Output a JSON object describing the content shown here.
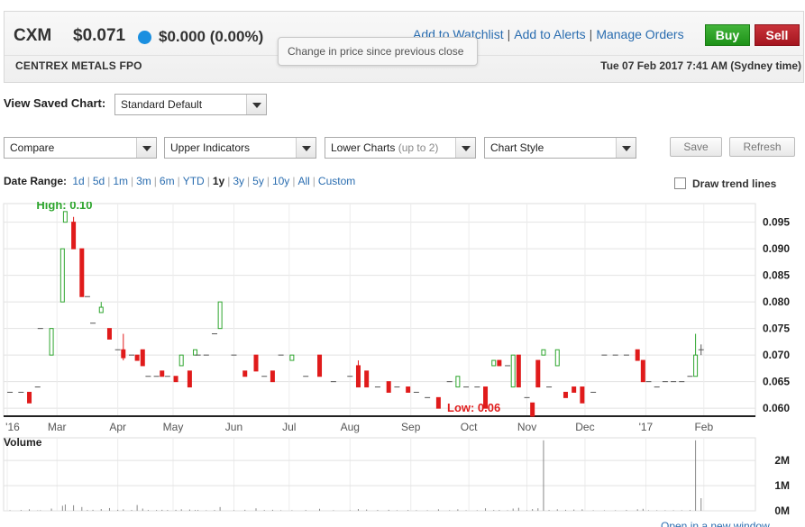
{
  "quote": {
    "ticker": "CXM",
    "price": "$0.071",
    "change": "$0.000 (0.00%)",
    "company": "CENTREX METALS FPO",
    "datetime": "Tue 07 Feb 2017 7:41 AM (Sydney time)",
    "tooltip": "Change in price since previous close"
  },
  "links": {
    "watchlist": "Add to Watchlist",
    "alerts": "Add to Alerts",
    "orders": "Manage Orders"
  },
  "buttons": {
    "buy": "Buy",
    "sell": "Sell",
    "save": "Save",
    "refresh": "Refresh"
  },
  "saved_chart": {
    "label": "View Saved Chart:",
    "value": "Standard Default"
  },
  "controls": {
    "compare": "Compare",
    "upper": "Upper Indicators",
    "lower": "Lower Charts",
    "lower_hint": "(up to 2)",
    "style": "Chart Style"
  },
  "date_range": {
    "label": "Date Range:",
    "options": [
      "1d",
      "5d",
      "1m",
      "3m",
      "6m",
      "YTD",
      "1y",
      "3y",
      "5y",
      "10y",
      "All",
      "Custom"
    ],
    "active": "1y"
  },
  "trend_label": "Draw trend lines",
  "open_window": "Open in a new window",
  "colors": {
    "up": "#2da52d",
    "down": "#e01b1b",
    "neutral": "#555555",
    "accent": "#1a8fe0"
  },
  "chart_data": {
    "type": "candlestick",
    "high_label": "High: 0.10",
    "low_label": "Low: 0.06",
    "ylim": [
      0.0585,
      0.0985
    ],
    "yticks": [
      0.095,
      0.09,
      0.085,
      0.08,
      0.075,
      0.07,
      0.065,
      0.06
    ],
    "ytick_labels": [
      "0.095",
      "0.090",
      "0.085",
      "0.080",
      "0.075",
      "0.070",
      "0.065",
      "0.060"
    ],
    "xrange": [
      0,
      270
    ],
    "xticks": [
      {
        "label": "'16",
        "x": 0
      },
      {
        "label": "Mar",
        "x": 18
      },
      {
        "label": "Apr",
        "x": 40
      },
      {
        "label": "May",
        "x": 60
      },
      {
        "label": "Jun",
        "x": 82
      },
      {
        "label": "Jul",
        "x": 102
      },
      {
        "label": "Aug",
        "x": 124
      },
      {
        "label": "Sep",
        "x": 146
      },
      {
        "label": "Oct",
        "x": 167
      },
      {
        "label": "Nov",
        "x": 188
      },
      {
        "label": "Dec",
        "x": 209
      },
      {
        "label": "'17",
        "x": 231
      },
      {
        "label": "Feb",
        "x": 252
      }
    ],
    "volume_label": "Volume",
    "volume_ticks": [
      "2M",
      "1M",
      "0M"
    ],
    "volume_ylim": [
      0,
      2900000
    ],
    "candles": [
      {
        "x": 1,
        "o": 0.063,
        "c": 0.063,
        "h": 0.063,
        "l": 0.063,
        "v": 20000
      },
      {
        "x": 5,
        "o": 0.063,
        "c": 0.063,
        "h": 0.063,
        "l": 0.063,
        "v": 30000
      },
      {
        "x": 8,
        "o": 0.063,
        "c": 0.061,
        "h": 0.063,
        "l": 0.061,
        "v": 60000
      },
      {
        "x": 11,
        "o": 0.064,
        "c": 0.064,
        "h": 0.064,
        "l": 0.064,
        "v": 15000
      },
      {
        "x": 12,
        "o": 0.075,
        "c": 0.075,
        "h": 0.075,
        "l": 0.075,
        "v": 20000
      },
      {
        "x": 16,
        "o": 0.07,
        "c": 0.075,
        "h": 0.075,
        "l": 0.07,
        "v": 90000
      },
      {
        "x": 20,
        "o": 0.08,
        "c": 0.09,
        "h": 0.09,
        "l": 0.08,
        "v": 200000
      },
      {
        "x": 21,
        "o": 0.095,
        "c": 0.097,
        "h": 0.097,
        "l": 0.095,
        "v": 250000
      },
      {
        "x": 24,
        "o": 0.095,
        "c": 0.09,
        "h": 0.096,
        "l": 0.09,
        "v": 220000
      },
      {
        "x": 27,
        "o": 0.09,
        "c": 0.081,
        "h": 0.09,
        "l": 0.081,
        "v": 150000
      },
      {
        "x": 29,
        "o": 0.081,
        "c": 0.081,
        "h": 0.081,
        "l": 0.081,
        "v": 30000
      },
      {
        "x": 31,
        "o": 0.076,
        "c": 0.076,
        "h": 0.076,
        "l": 0.076,
        "v": 40000
      },
      {
        "x": 34,
        "o": 0.078,
        "c": 0.079,
        "h": 0.08,
        "l": 0.078,
        "v": 70000
      },
      {
        "x": 37,
        "o": 0.075,
        "c": 0.073,
        "h": 0.075,
        "l": 0.073,
        "v": 110000
      },
      {
        "x": 40,
        "o": 0.071,
        "c": 0.071,
        "h": 0.071,
        "l": 0.071,
        "v": 40000
      },
      {
        "x": 42,
        "o": 0.071,
        "c": 0.0695,
        "h": 0.074,
        "l": 0.069,
        "v": 60000
      },
      {
        "x": 45,
        "o": 0.07,
        "c": 0.07,
        "h": 0.07,
        "l": 0.07,
        "v": 30000
      },
      {
        "x": 47,
        "o": 0.07,
        "c": 0.069,
        "h": 0.07,
        "l": 0.069,
        "v": 230000
      },
      {
        "x": 49,
        "o": 0.071,
        "c": 0.068,
        "h": 0.071,
        "l": 0.068,
        "v": 90000
      },
      {
        "x": 51,
        "o": 0.066,
        "c": 0.066,
        "h": 0.066,
        "l": 0.066,
        "v": 30000
      },
      {
        "x": 54,
        "o": 0.066,
        "c": 0.066,
        "h": 0.066,
        "l": 0.066,
        "v": 30000
      },
      {
        "x": 56,
        "o": 0.067,
        "c": 0.066,
        "h": 0.067,
        "l": 0.066,
        "v": 40000
      },
      {
        "x": 58,
        "o": 0.066,
        "c": 0.066,
        "h": 0.066,
        "l": 0.066,
        "v": 30000
      },
      {
        "x": 61,
        "o": 0.066,
        "c": 0.065,
        "h": 0.066,
        "l": 0.065,
        "v": 40000
      },
      {
        "x": 63,
        "o": 0.068,
        "c": 0.07,
        "h": 0.07,
        "l": 0.068,
        "v": 60000
      },
      {
        "x": 66,
        "o": 0.067,
        "c": 0.064,
        "h": 0.067,
        "l": 0.064,
        "v": 50000
      },
      {
        "x": 68,
        "o": 0.07,
        "c": 0.071,
        "h": 0.071,
        "l": 0.07,
        "v": 30000
      },
      {
        "x": 69,
        "o": 0.07,
        "c": 0.07,
        "h": 0.07,
        "l": 0.07,
        "v": 30000
      },
      {
        "x": 72,
        "o": 0.07,
        "c": 0.07,
        "h": 0.07,
        "l": 0.07,
        "v": 20000
      },
      {
        "x": 75,
        "o": 0.074,
        "c": 0.074,
        "h": 0.074,
        "l": 0.074,
        "v": 30000
      },
      {
        "x": 77,
        "o": 0.075,
        "c": 0.08,
        "h": 0.08,
        "l": 0.075,
        "v": 150000
      },
      {
        "x": 82,
        "o": 0.07,
        "c": 0.07,
        "h": 0.07,
        "l": 0.07,
        "v": 20000
      },
      {
        "x": 86,
        "o": 0.067,
        "c": 0.066,
        "h": 0.067,
        "l": 0.066,
        "v": 40000
      },
      {
        "x": 90,
        "o": 0.07,
        "c": 0.067,
        "h": 0.07,
        "l": 0.067,
        "v": 100000
      },
      {
        "x": 93,
        "o": 0.066,
        "c": 0.066,
        "h": 0.066,
        "l": 0.066,
        "v": 30000
      },
      {
        "x": 96,
        "o": 0.067,
        "c": 0.065,
        "h": 0.067,
        "l": 0.065,
        "v": 40000
      },
      {
        "x": 99,
        "o": 0.07,
        "c": 0.07,
        "h": 0.07,
        "l": 0.07,
        "v": 20000
      },
      {
        "x": 103,
        "o": 0.069,
        "c": 0.07,
        "h": 0.07,
        "l": 0.069,
        "v": 20000
      },
      {
        "x": 108,
        "o": 0.066,
        "c": 0.066,
        "h": 0.066,
        "l": 0.066,
        "v": 30000
      },
      {
        "x": 113,
        "o": 0.07,
        "c": 0.066,
        "h": 0.07,
        "l": 0.066,
        "v": 80000
      },
      {
        "x": 118,
        "o": 0.065,
        "c": 0.065,
        "h": 0.065,
        "l": 0.065,
        "v": 20000
      },
      {
        "x": 124,
        "o": 0.066,
        "c": 0.066,
        "h": 0.066,
        "l": 0.066,
        "v": 20000
      },
      {
        "x": 127,
        "o": 0.068,
        "c": 0.064,
        "h": 0.069,
        "l": 0.064,
        "v": 70000
      },
      {
        "x": 130,
        "o": 0.067,
        "c": 0.064,
        "h": 0.067,
        "l": 0.064,
        "v": 50000
      },
      {
        "x": 134,
        "o": 0.064,
        "c": 0.064,
        "h": 0.064,
        "l": 0.064,
        "v": 30000
      },
      {
        "x": 138,
        "o": 0.065,
        "c": 0.063,
        "h": 0.065,
        "l": 0.063,
        "v": 40000
      },
      {
        "x": 141,
        "o": 0.064,
        "c": 0.064,
        "h": 0.064,
        "l": 0.064,
        "v": 20000
      },
      {
        "x": 145,
        "o": 0.064,
        "c": 0.063,
        "h": 0.064,
        "l": 0.063,
        "v": 30000
      },
      {
        "x": 148,
        "o": 0.063,
        "c": 0.063,
        "h": 0.063,
        "l": 0.063,
        "v": 20000
      },
      {
        "x": 152,
        "o": 0.062,
        "c": 0.062,
        "h": 0.062,
        "l": 0.062,
        "v": 20000
      },
      {
        "x": 156,
        "o": 0.062,
        "c": 0.06,
        "h": 0.062,
        "l": 0.06,
        "v": 60000
      },
      {
        "x": 160,
        "o": 0.065,
        "c": 0.065,
        "h": 0.065,
        "l": 0.065,
        "v": 20000
      },
      {
        "x": 163,
        "o": 0.064,
        "c": 0.066,
        "h": 0.066,
        "l": 0.064,
        "v": 60000
      },
      {
        "x": 166,
        "o": 0.064,
        "c": 0.064,
        "h": 0.064,
        "l": 0.064,
        "v": 20000
      },
      {
        "x": 170,
        "o": 0.064,
        "c": 0.064,
        "h": 0.064,
        "l": 0.064,
        "v": 20000
      },
      {
        "x": 173,
        "o": 0.064,
        "c": 0.06,
        "h": 0.064,
        "l": 0.06,
        "v": 100000
      },
      {
        "x": 176,
        "o": 0.068,
        "c": 0.069,
        "h": 0.069,
        "l": 0.068,
        "v": 30000
      },
      {
        "x": 178,
        "o": 0.069,
        "c": 0.068,
        "h": 0.069,
        "l": 0.068,
        "v": 30000
      },
      {
        "x": 181,
        "o": 0.068,
        "c": 0.068,
        "h": 0.068,
        "l": 0.068,
        "v": 20000
      },
      {
        "x": 183,
        "o": 0.064,
        "c": 0.07,
        "h": 0.07,
        "l": 0.064,
        "v": 90000
      },
      {
        "x": 185,
        "o": 0.07,
        "c": 0.064,
        "h": 0.07,
        "l": 0.064,
        "v": 120000
      },
      {
        "x": 188,
        "o": 0.062,
        "c": 0.062,
        "h": 0.062,
        "l": 0.062,
        "v": 20000
      },
      {
        "x": 190,
        "o": 0.061,
        "c": 0.0585,
        "h": 0.061,
        "l": 0.0585,
        "v": 70000
      },
      {
        "x": 192,
        "o": 0.069,
        "c": 0.064,
        "h": 0.069,
        "l": 0.064,
        "v": 100000
      },
      {
        "x": 194,
        "o": 0.07,
        "c": 0.071,
        "h": 0.071,
        "l": 0.07,
        "v": 2800000
      },
      {
        "x": 196,
        "o": 0.064,
        "c": 0.064,
        "h": 0.064,
        "l": 0.064,
        "v": 30000
      },
      {
        "x": 199,
        "o": 0.068,
        "c": 0.071,
        "h": 0.071,
        "l": 0.068,
        "v": 60000
      },
      {
        "x": 202,
        "o": 0.063,
        "c": 0.062,
        "h": 0.063,
        "l": 0.062,
        "v": 40000
      },
      {
        "x": 205,
        "o": 0.064,
        "c": 0.063,
        "h": 0.064,
        "l": 0.063,
        "v": 50000
      },
      {
        "x": 208,
        "o": 0.064,
        "c": 0.061,
        "h": 0.064,
        "l": 0.061,
        "v": 60000
      },
      {
        "x": 212,
        "o": 0.063,
        "c": 0.063,
        "h": 0.063,
        "l": 0.063,
        "v": 20000
      },
      {
        "x": 216,
        "o": 0.07,
        "c": 0.07,
        "h": 0.07,
        "l": 0.07,
        "v": 20000
      },
      {
        "x": 220,
        "o": 0.07,
        "c": 0.07,
        "h": 0.07,
        "l": 0.07,
        "v": 20000
      },
      {
        "x": 224,
        "o": 0.07,
        "c": 0.07,
        "h": 0.07,
        "l": 0.07,
        "v": 30000
      },
      {
        "x": 228,
        "o": 0.071,
        "c": 0.069,
        "h": 0.071,
        "l": 0.069,
        "v": 60000
      },
      {
        "x": 230,
        "o": 0.069,
        "c": 0.065,
        "h": 0.069,
        "l": 0.065,
        "v": 80000
      },
      {
        "x": 232,
        "o": 0.065,
        "c": 0.065,
        "h": 0.065,
        "l": 0.065,
        "v": 20000
      },
      {
        "x": 235,
        "o": 0.064,
        "c": 0.064,
        "h": 0.064,
        "l": 0.064,
        "v": 20000
      },
      {
        "x": 238,
        "o": 0.065,
        "c": 0.065,
        "h": 0.065,
        "l": 0.065,
        "v": 20000
      },
      {
        "x": 241,
        "o": 0.065,
        "c": 0.065,
        "h": 0.065,
        "l": 0.065,
        "v": 20000
      },
      {
        "x": 244,
        "o": 0.065,
        "c": 0.065,
        "h": 0.065,
        "l": 0.065,
        "v": 20000
      },
      {
        "x": 247,
        "o": 0.066,
        "c": 0.066,
        "h": 0.066,
        "l": 0.066,
        "v": 30000
      },
      {
        "x": 249,
        "o": 0.066,
        "c": 0.07,
        "h": 0.074,
        "l": 0.066,
        "v": 2800000
      },
      {
        "x": 251,
        "o": 0.071,
        "c": 0.071,
        "h": 0.072,
        "l": 0.07,
        "v": 500000
      }
    ]
  }
}
